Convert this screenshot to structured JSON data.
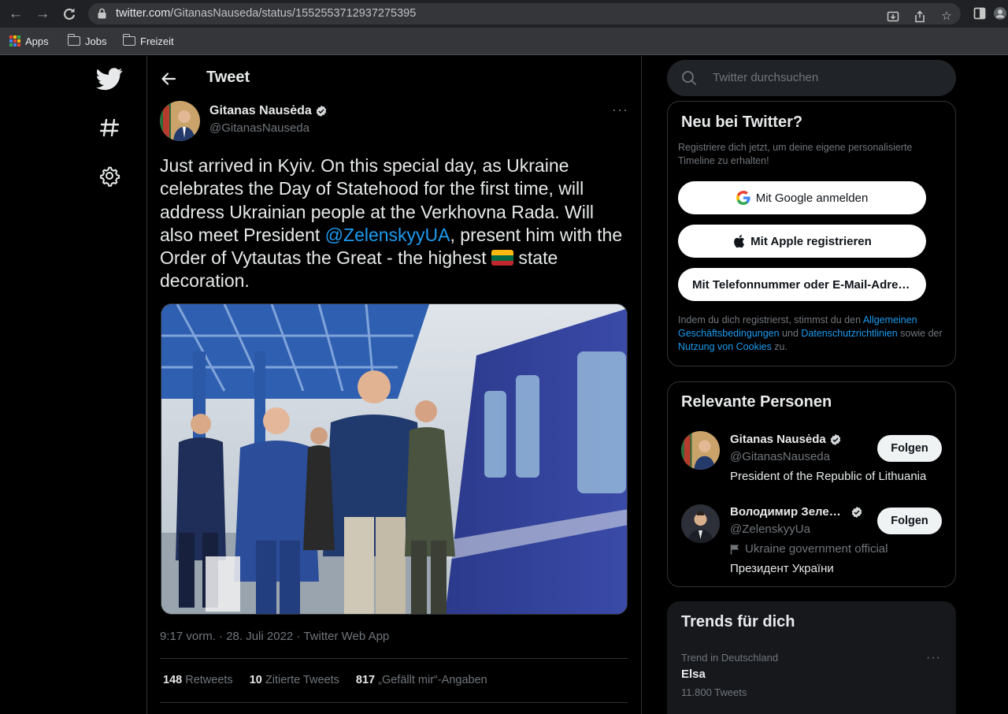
{
  "browser": {
    "url_host": "twitter.com",
    "url_path": "/GitanasNauseda/status/1552553712937275395",
    "bookmarks": [
      "Apps",
      "Jobs",
      "Freizeit"
    ]
  },
  "nav": {
    "icons": [
      "twitter-bird-icon",
      "hashtag-icon",
      "settings-gear-icon"
    ]
  },
  "tweet_page": {
    "title": "Tweet",
    "author": {
      "name": "Gitanas Nausėda",
      "handle": "@GitanasNauseda"
    },
    "text_before_mention": "Just arrived in Kyiv. On this special day, as Ukraine celebrates the Day of Statehood for the first time, will address Ukrainian people at the Verkhovna Rada. Will also meet President ",
    "mention": "@ZelenskyyUA",
    "text_after_mention": ", present him with the Order of Vytautas the Great - the highest ",
    "text_end": " state decoration.",
    "meta": "9:17 vorm. · 28. Juli 2022 · Twitter Web App",
    "stats": {
      "retweets_count": "148",
      "retweets_label": "Retweets",
      "quotes_count": "10",
      "quotes_label": "Zitierte Tweets",
      "likes_count": "817",
      "likes_label": "„Gefällt mir“-Angaben"
    }
  },
  "sidebar": {
    "search_placeholder": "Twitter durchsuchen",
    "signup": {
      "title": "Neu bei Twitter?",
      "subtitle": "Registriere dich jetzt, um deine eigene personalisierte Timeline zu erhalten!",
      "google_button": "Mit Google anmelden",
      "apple_button": "Mit Apple registrieren",
      "phone_button": "Mit Telefonnummer oder E-Mail-Adresse registrieren",
      "legal_1": "Indem du dich registrierst, stimmst du den ",
      "legal_link_1": "Allgemeinen Geschäftsbedingungen",
      "legal_2": " und ",
      "legal_link_2": "Datenschutzrichtlinien",
      "legal_3": " sowie der ",
      "legal_link_3": "Nutzung von Cookies",
      "legal_4": " zu."
    },
    "people": {
      "title": "Relevante Personen",
      "items": [
        {
          "name": "Gitanas Nausėda",
          "handle": "@GitanasNauseda",
          "label": "",
          "bio": "President of the Republic of Lithuania",
          "follow": "Folgen"
        },
        {
          "name": "Володимир Зеле…",
          "handle": "@ZelenskyyUa",
          "label": "Ukraine government official",
          "bio": "Президент України",
          "follow": "Folgen"
        }
      ]
    },
    "trends": {
      "title": "Trends für dich",
      "items": [
        {
          "context": "Trend in Deutschland",
          "name": "Elsa",
          "count": "11.800 Tweets"
        }
      ]
    }
  },
  "colors": {
    "accent": "#1d9bf0",
    "background": "#000000",
    "text_primary": "#e7e9ea",
    "text_secondary": "#71767b",
    "border": "#2f3336"
  }
}
